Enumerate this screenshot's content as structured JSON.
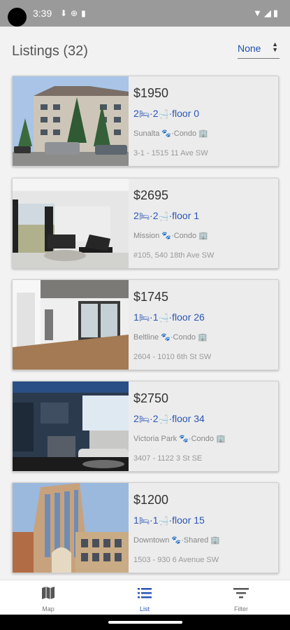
{
  "status": {
    "time": "3:39",
    "left_icons": "⬇⊕▮",
    "right_icons": "▼◢▮"
  },
  "header": {
    "title": "Listings (32)",
    "sort_value": "None"
  },
  "listings": [
    {
      "price": "$1950",
      "beds": "2",
      "baths": "2",
      "floor": "floor 0",
      "neighbourhood": "Sunalta",
      "type": "Condo",
      "address": "3-1 - 1515 11 Ave SW"
    },
    {
      "price": "$2695",
      "beds": "2",
      "baths": "2",
      "floor": "floor 1",
      "neighbourhood": "Mission",
      "type": "Condo",
      "address": "#105, 540 18th Ave SW"
    },
    {
      "price": "$1745",
      "beds": "1",
      "baths": "1",
      "floor": "floor 26",
      "neighbourhood": "Beltline",
      "type": "Condo",
      "address": "2604 - 1010 6th St SW"
    },
    {
      "price": "$2750",
      "beds": "2",
      "baths": "2",
      "floor": "floor 34",
      "neighbourhood": "Victoria Park",
      "type": "Condo",
      "address": "3407 - 1122 3 St SE"
    },
    {
      "price": "$1200",
      "beds": "1",
      "baths": "1",
      "floor": "floor 15",
      "neighbourhood": "Downtown",
      "type": "Shared",
      "address": "1503 - 930 6 Avenue SW"
    }
  ],
  "icons": {
    "bed": "bed-icon",
    "bath": "bath-icon",
    "pet": "paw-icon",
    "building": "building-icon"
  },
  "bottom_nav": [
    {
      "label": "Map",
      "icon": "map-icon",
      "active": false
    },
    {
      "label": "List",
      "icon": "list-icon",
      "active": true
    },
    {
      "label": "Filter",
      "icon": "filter-icon",
      "active": false
    }
  ],
  "colors": {
    "accent": "#2a55b5",
    "status_bar": "#9a9a9a"
  }
}
